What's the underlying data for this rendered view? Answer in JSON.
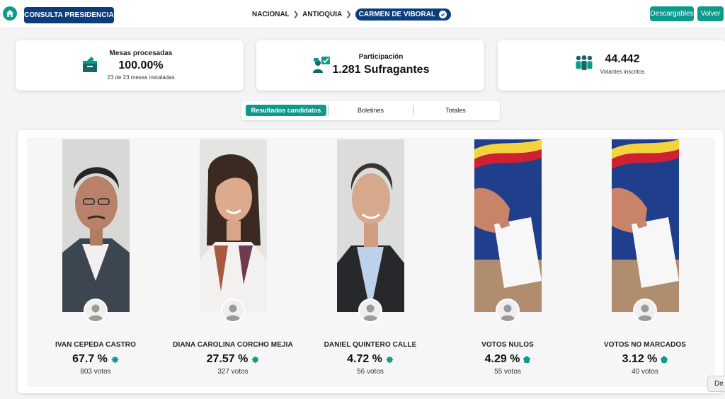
{
  "header": {
    "consulta_label": "CONSULTA PRESIDENCIA",
    "breadcrumb": [
      "NACIONAL",
      "ANTIOQUIA",
      "CARMEN DE VIBORAL"
    ],
    "descargables_label": "Descargables",
    "volver_label": "Volver"
  },
  "stats": {
    "mesas": {
      "title": "Mesas procesadas",
      "value": "100.00%",
      "sub": "23 de 23 mesas instaladas"
    },
    "participacion": {
      "title": "Participación",
      "value": "1.281 Sufragantes"
    },
    "votantes": {
      "value": "44.442",
      "sub": "Votantes inscritos"
    }
  },
  "tabs": [
    "Resultados candidatos",
    "Boletines",
    "Totales"
  ],
  "candidates": [
    {
      "name": "IVAN CEPEDA CASTRO",
      "pct": "67.7 %",
      "votes": "803 votos"
    },
    {
      "name": "DIANA CAROLINA CORCHO MEJIA",
      "pct": "27.57 %",
      "votes": "327 votos"
    },
    {
      "name": "DANIEL QUINTERO CALLE",
      "pct": "4.72 %",
      "votes": "56 votos"
    },
    {
      "name": "VOTOS NULOS",
      "pct": "4.29 %",
      "votes": "55 votos"
    },
    {
      "name": "VOTOS NO MARCADOS",
      "pct": "3.12 %",
      "votes": "40 votos"
    }
  ],
  "floating_button_label": "De",
  "colors": {
    "navy": "#0c3d7c",
    "teal": "#0e9a8a"
  }
}
